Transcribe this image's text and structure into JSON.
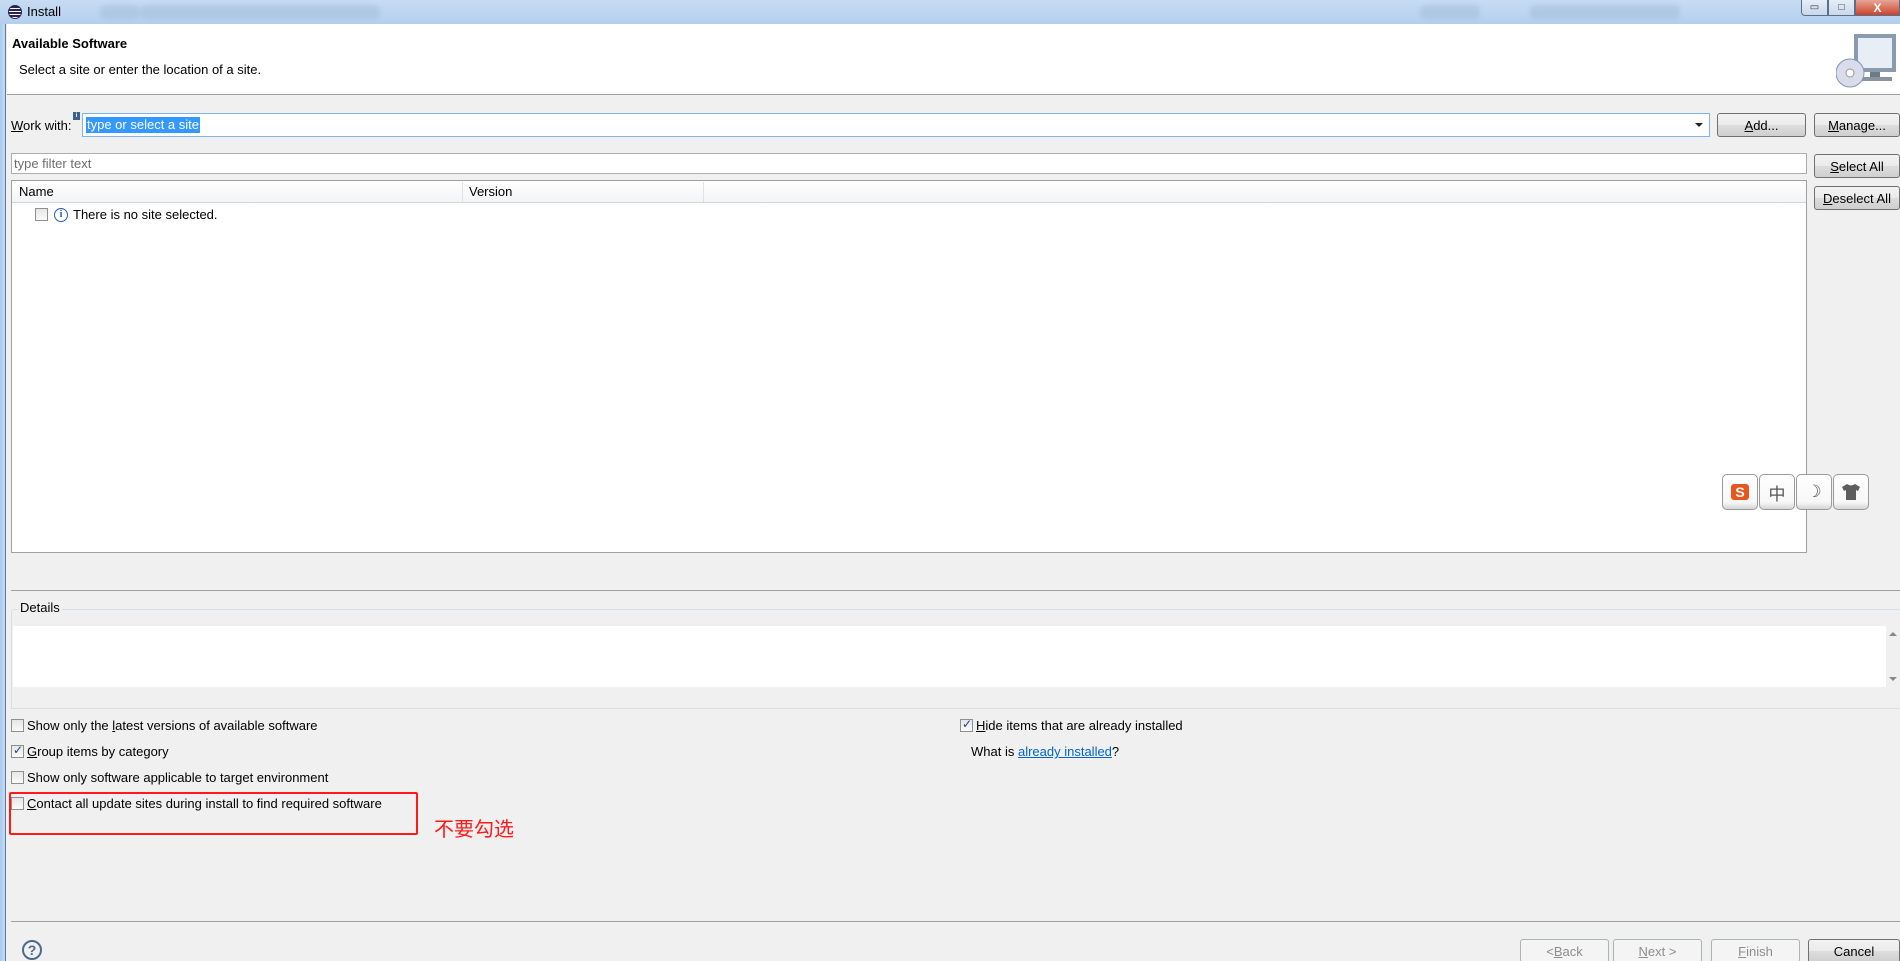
{
  "window": {
    "title": "Install",
    "minimize_glyph": "▭",
    "maximize_glyph": "□",
    "close_glyph": "X"
  },
  "header": {
    "title": "Available Software",
    "subtitle": "Select a site or enter the location of a site."
  },
  "work_with": {
    "label_prefix": "W",
    "label_rest": "ork with:",
    "info_badge": "i",
    "value": "type or select a site",
    "add_prefix": "A",
    "add_rest": "dd...",
    "manage_prefix": "M",
    "manage_rest": "anage..."
  },
  "filter": {
    "placeholder": "type filter text"
  },
  "side_buttons": {
    "select_all_prefix": "S",
    "select_all_rest": "elect All",
    "deselect_all_prefix": "D",
    "deselect_all_rest": "eselect All"
  },
  "table": {
    "columns": [
      "Name",
      "Version"
    ],
    "rows": [
      {
        "checked": false,
        "icon": "info-icon",
        "text": "There is no site selected."
      }
    ]
  },
  "ime_toolbar": {
    "items": [
      {
        "name": "sogou-logo",
        "glyph": "S",
        "color": "#e8561e"
      },
      {
        "name": "chinese-mode",
        "glyph": "中",
        "color": "#555555"
      },
      {
        "name": "moon",
        "glyph": "☽",
        "color": "#555555"
      },
      {
        "name": "tshirt",
        "glyph": "👕",
        "color": "#5d5d5d"
      }
    ]
  },
  "details": {
    "label": "Details",
    "content": ""
  },
  "options": {
    "latest_versions": {
      "checked": false,
      "pre": "Show only the ",
      "ul": "l",
      "post": "atest versions of available software"
    },
    "group_by_category": {
      "checked": true,
      "pre": "",
      "ul": "G",
      "post": "roup items by category"
    },
    "target_env": {
      "checked": false,
      "pre": "Show only software applicable to target environment",
      "ul": "",
      "post": ""
    },
    "contact_sites": {
      "checked": false,
      "pre": "",
      "ul": "C",
      "post": "ontact all update sites during install to find required software"
    },
    "hide_installed": {
      "checked": true,
      "pre": "",
      "ul": "H",
      "post": "ide items that are already installed"
    },
    "what_is_prefix": "What is ",
    "what_is_link": "already installed",
    "what_is_suffix": "?"
  },
  "annotation": {
    "text": "不要勾选",
    "color": "#ff1a1a"
  },
  "footer": {
    "help_glyph": "?",
    "back": {
      "pre": "< ",
      "ul": "B",
      "post": "ack",
      "enabled": false
    },
    "next": {
      "pre": "",
      "ul": "N",
      "post": "ext >",
      "enabled": false
    },
    "finish": {
      "pre": "",
      "ul": "F",
      "post": "inish",
      "enabled": false
    },
    "cancel": {
      "label": "Cancel",
      "enabled": true
    }
  }
}
